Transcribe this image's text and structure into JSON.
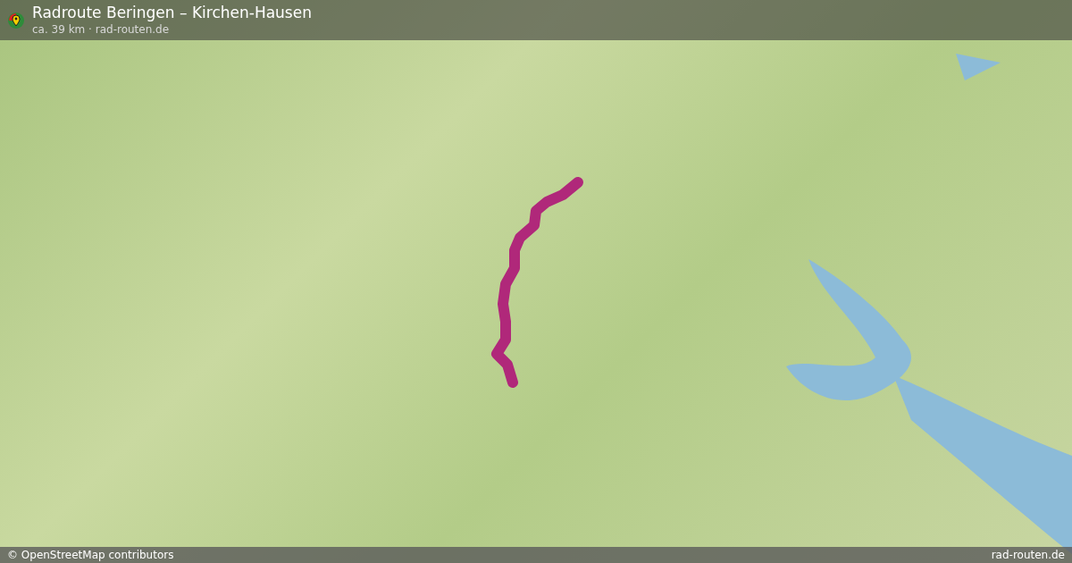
{
  "header": {
    "title": "Radroute Beringen – Kirchen-Hausen",
    "subtitle": "ca. 39 km · rad-routen.de"
  },
  "footer": {
    "attribution": "© OpenStreetMap contributors",
    "site": "rad-routen.de"
  }
}
